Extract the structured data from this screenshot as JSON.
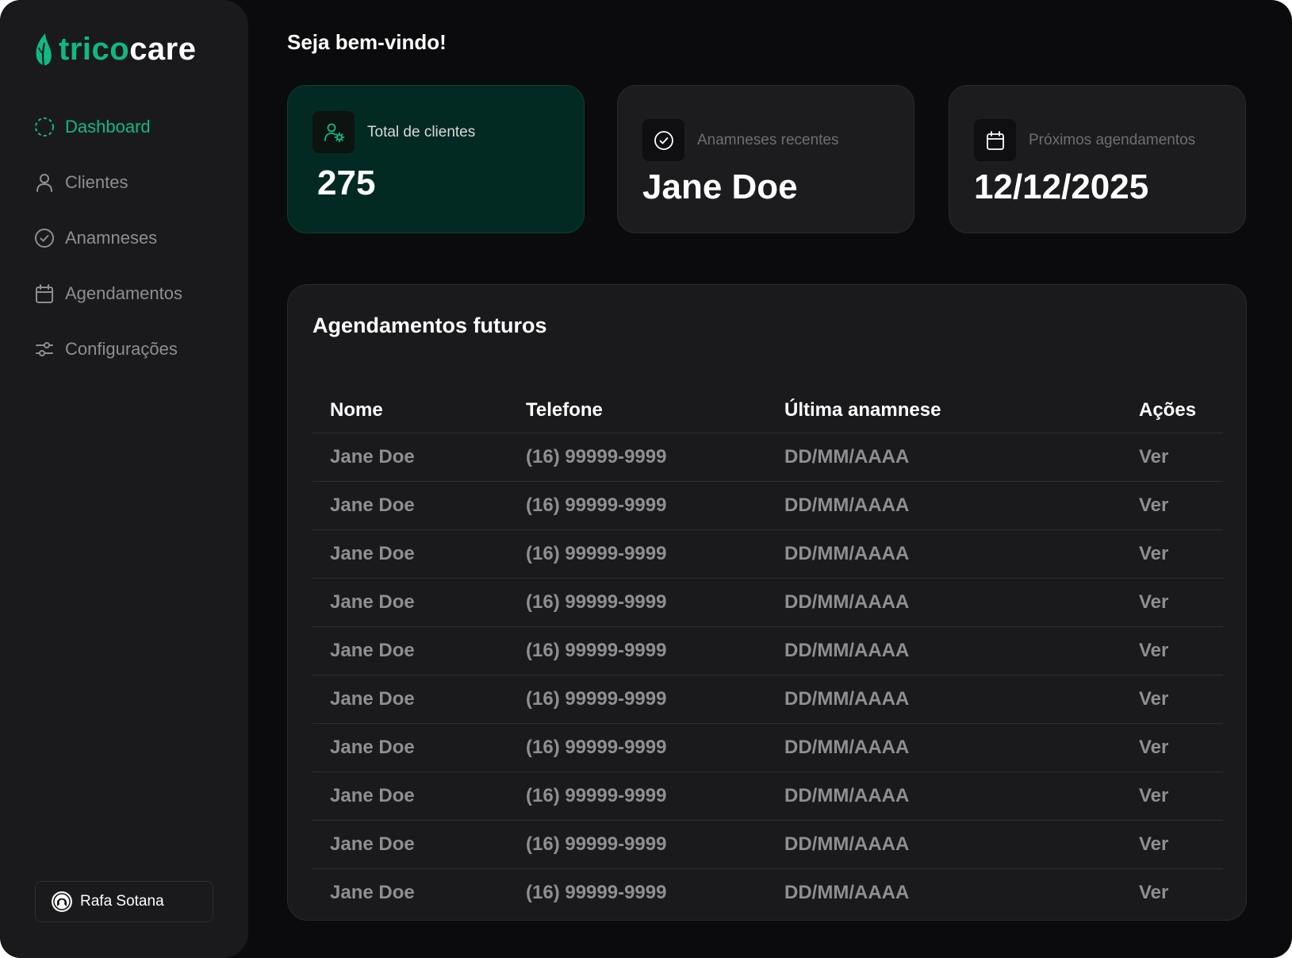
{
  "brand": {
    "part1": "trico",
    "part2": "care",
    "accent": "#10b981"
  },
  "nav": {
    "items": [
      {
        "label": "Dashboard",
        "icon": "dashboard-icon",
        "active": true
      },
      {
        "label": "Clientes",
        "icon": "user-icon"
      },
      {
        "label": "Anamneses",
        "icon": "check-circle-icon"
      },
      {
        "label": "Agendamentos",
        "icon": "calendar-icon"
      },
      {
        "label": "Configurações",
        "icon": "sliders-icon"
      }
    ]
  },
  "user": {
    "name": "Rafa Sotana"
  },
  "header": {
    "welcome": "Seja bem-vindo!"
  },
  "cards": [
    {
      "label": "Total de clientes",
      "value": "275",
      "icon": "users-gear-icon"
    },
    {
      "label": "Anamneses recentes",
      "value": "Jane Doe",
      "icon": "check-circle-icon"
    },
    {
      "label": "Próximos agendamentos",
      "value": "12/12/2025",
      "icon": "calendar-icon"
    }
  ],
  "table": {
    "title": "Agendamentos futuros",
    "headers": [
      "Nome",
      "Telefone",
      "Última anamnese",
      "Ações"
    ],
    "rows": [
      [
        "Jane Doe",
        "(16) 99999-9999",
        "DD/MM/AAAA",
        "Ver"
      ],
      [
        "Jane Doe",
        "(16) 99999-9999",
        "DD/MM/AAAA",
        "Ver"
      ],
      [
        "Jane Doe",
        "(16) 99999-9999",
        "DD/MM/AAAA",
        "Ver"
      ],
      [
        "Jane Doe",
        "(16) 99999-9999",
        "DD/MM/AAAA",
        "Ver"
      ],
      [
        "Jane Doe",
        "(16) 99999-9999",
        "DD/MM/AAAA",
        "Ver"
      ],
      [
        "Jane Doe",
        "(16) 99999-9999",
        "DD/MM/AAAA",
        "Ver"
      ],
      [
        "Jane Doe",
        "(16) 99999-9999",
        "DD/MM/AAAA",
        "Ver"
      ],
      [
        "Jane Doe",
        "(16) 99999-9999",
        "DD/MM/AAAA",
        "Ver"
      ],
      [
        "Jane Doe",
        "(16) 99999-9999",
        "DD/MM/AAAA",
        "Ver"
      ],
      [
        "Jane Doe",
        "(16) 99999-9999",
        "DD/MM/AAAA",
        "Ver"
      ]
    ]
  }
}
